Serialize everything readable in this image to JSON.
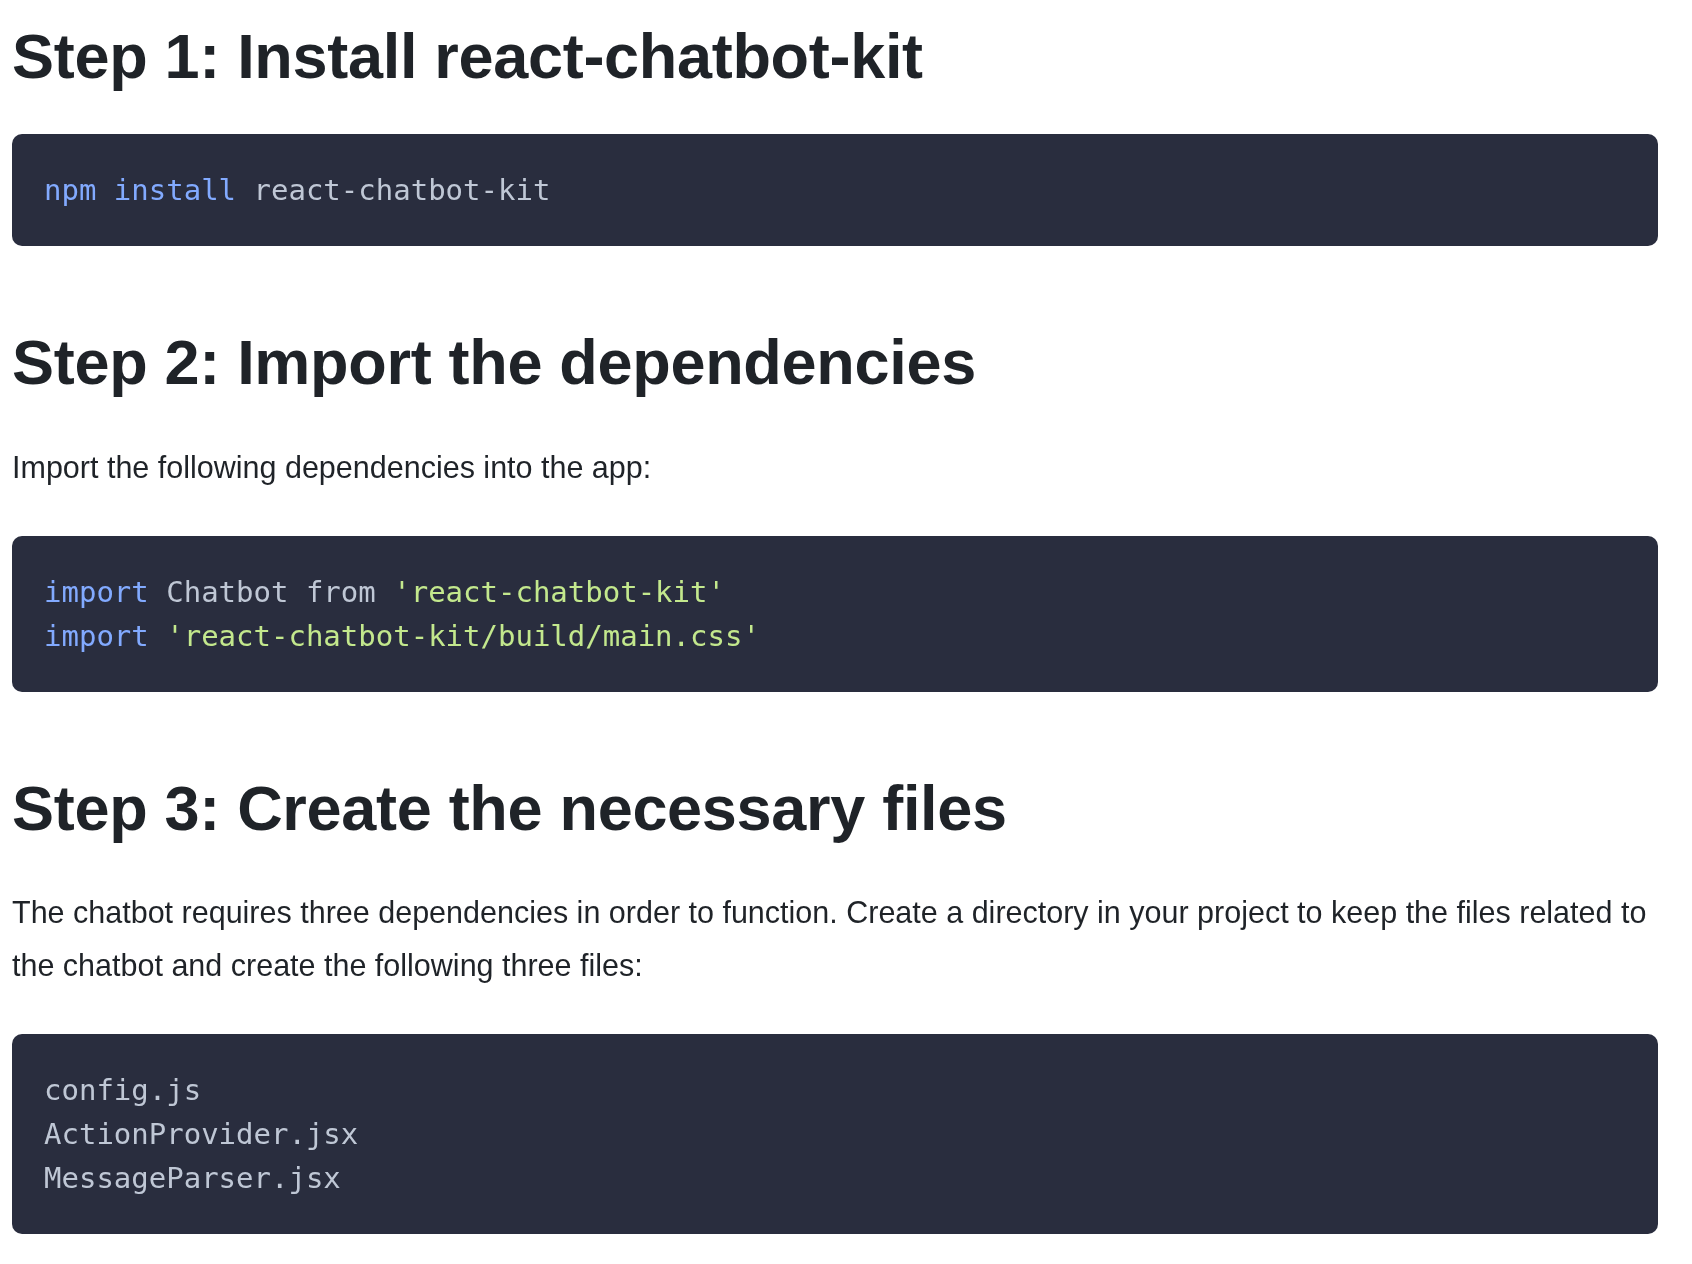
{
  "sections": [
    {
      "heading": "Step 1: Install react-chatbot-kit",
      "code": [
        [
          {
            "kind": "keyword",
            "text": "npm install"
          },
          {
            "kind": "plain",
            "text": "react-chatbot-kit"
          }
        ]
      ]
    },
    {
      "heading": "Step 2: Import the dependencies",
      "paragraph": "Import the following dependencies into the app:",
      "code": [
        [
          {
            "kind": "keyword",
            "text": "import"
          },
          {
            "kind": "plain",
            "text": "Chatbot from"
          },
          {
            "kind": "string",
            "text": "'react-chatbot-kit'"
          }
        ],
        [
          {
            "kind": "keyword",
            "text": "import"
          },
          {
            "kind": "string",
            "text": "'react-chatbot-kit/build/main.css'"
          }
        ]
      ]
    },
    {
      "heading": "Step 3: Create the necessary files",
      "paragraph": "The chatbot requires three dependencies in order to function. Create a directory in your project to keep the files related to the chatbot and create the following three files:",
      "code": [
        [
          {
            "kind": "plain",
            "text": "config.js"
          }
        ],
        [
          {
            "kind": "plain",
            "text": "ActionProvider.jsx"
          }
        ],
        [
          {
            "kind": "plain",
            "text": "MessageParser.jsx"
          }
        ]
      ]
    }
  ]
}
